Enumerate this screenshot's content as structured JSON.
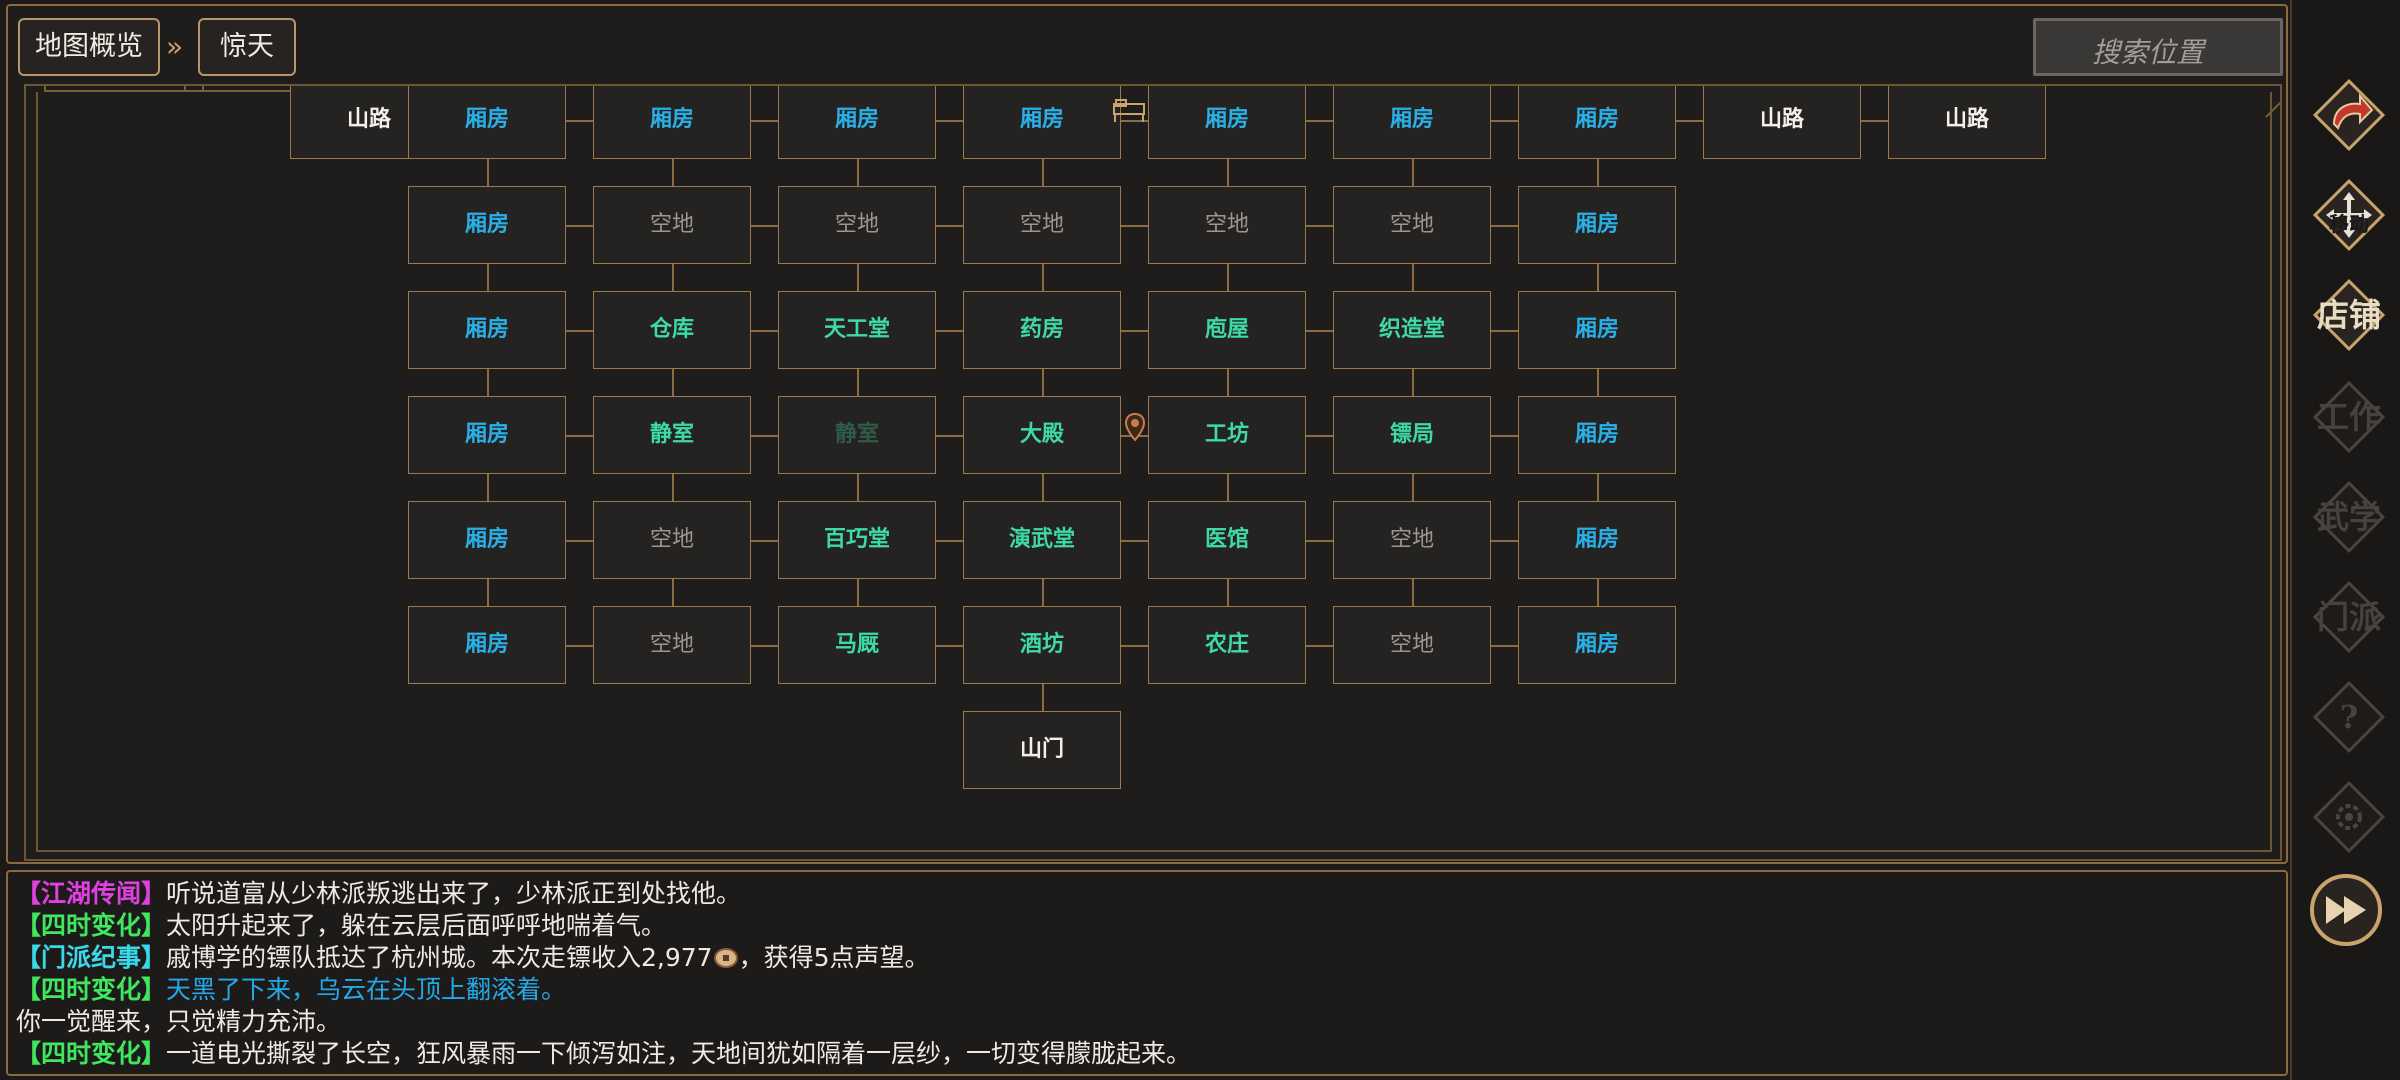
{
  "breadcrumb": {
    "overview_label": "地图概览",
    "separator": "»",
    "current_label": "惊天"
  },
  "search": {
    "placeholder": "搜索位置"
  },
  "map": {
    "rows": [
      [
        {
          "label": "山路",
          "kind": "road"
        },
        {
          "label": "厢房",
          "kind": "wing"
        },
        {
          "label": "厢房",
          "kind": "wing"
        },
        {
          "label": "厢房",
          "kind": "wing"
        },
        {
          "label": "厢房",
          "kind": "wing"
        },
        {
          "label": "厢房",
          "kind": "wing"
        },
        {
          "label": "厢房",
          "kind": "wing"
        },
        {
          "label": "厢房",
          "kind": "wing"
        },
        {
          "label": "山路",
          "kind": "road"
        },
        {
          "label": "山路",
          "kind": "road"
        }
      ],
      [
        null,
        {
          "label": "厢房",
          "kind": "wing"
        },
        {
          "label": "空地",
          "kind": "empty"
        },
        {
          "label": "空地",
          "kind": "empty"
        },
        {
          "label": "空地",
          "kind": "empty"
        },
        {
          "label": "空地",
          "kind": "empty"
        },
        {
          "label": "空地",
          "kind": "empty"
        },
        {
          "label": "厢房",
          "kind": "wing"
        },
        null,
        null
      ],
      [
        null,
        {
          "label": "厢房",
          "kind": "wing"
        },
        {
          "label": "仓库",
          "kind": "building"
        },
        {
          "label": "天工堂",
          "kind": "building"
        },
        {
          "label": "药房",
          "kind": "building"
        },
        {
          "label": "庖屋",
          "kind": "building"
        },
        {
          "label": "织造堂",
          "kind": "building"
        },
        {
          "label": "厢房",
          "kind": "wing"
        },
        null,
        null
      ],
      [
        null,
        {
          "label": "厢房",
          "kind": "wing"
        },
        {
          "label": "静室",
          "kind": "building"
        },
        {
          "label": "静室",
          "kind": "dim"
        },
        {
          "label": "大殿",
          "kind": "building"
        },
        {
          "label": "工坊",
          "kind": "building"
        },
        {
          "label": "镖局",
          "kind": "building"
        },
        {
          "label": "厢房",
          "kind": "wing"
        },
        null,
        null
      ],
      [
        null,
        {
          "label": "厢房",
          "kind": "wing"
        },
        {
          "label": "空地",
          "kind": "empty"
        },
        {
          "label": "百巧堂",
          "kind": "building"
        },
        {
          "label": "演武堂",
          "kind": "building"
        },
        {
          "label": "医馆",
          "kind": "building"
        },
        {
          "label": "空地",
          "kind": "empty"
        },
        {
          "label": "厢房",
          "kind": "wing"
        },
        null,
        null
      ],
      [
        null,
        {
          "label": "厢房",
          "kind": "wing"
        },
        {
          "label": "空地",
          "kind": "empty"
        },
        {
          "label": "马厩",
          "kind": "building"
        },
        {
          "label": "酒坊",
          "kind": "building"
        },
        {
          "label": "农庄",
          "kind": "building"
        },
        {
          "label": "空地",
          "kind": "empty"
        },
        {
          "label": "厢房",
          "kind": "wing"
        },
        null,
        null
      ],
      [
        null,
        null,
        null,
        null,
        {
          "label": "山门",
          "kind": "road"
        },
        null,
        null,
        null,
        null,
        null
      ]
    ]
  },
  "side_menu": [
    {
      "name": "back-button",
      "label": "",
      "icon": "return-arrow-icon",
      "enabled": true
    },
    {
      "name": "move-button",
      "label": "移动",
      "icon": "move-arrows-icon",
      "enabled": true
    },
    {
      "name": "shop-button",
      "label": "店铺",
      "icon": "shop-icon",
      "enabled": true
    },
    {
      "name": "work-button",
      "label": "工作",
      "icon": "work-icon",
      "enabled": false
    },
    {
      "name": "martial-button",
      "label": "武学",
      "icon": "martial-icon",
      "enabled": false
    },
    {
      "name": "sect-button",
      "label": "门派",
      "icon": "sect-icon",
      "enabled": false
    },
    {
      "name": "help-button",
      "label": "?",
      "icon": "question-icon",
      "enabled": false
    },
    {
      "name": "settings-button",
      "label": "",
      "icon": "gear-icon",
      "enabled": false
    }
  ],
  "fast_forward": {
    "icon": "fast-forward-icon"
  },
  "log": [
    {
      "tag": "【江湖传闻】",
      "tag_kind": "rumor",
      "text": "听说道富从少林派叛逃出来了，少林派正到处找他。",
      "text_kind": "normal"
    },
    {
      "tag": "【四时变化】",
      "tag_kind": "season",
      "text": "太阳升起来了，躲在云层后面呼呼地喘着气。",
      "text_kind": "normal"
    },
    {
      "tag": "【门派纪事】",
      "tag_kind": "sect",
      "text": "戚博学的镖队抵达了杭州城。本次走镖收入2,977",
      "coin": true,
      "text_after": "，获得5点声望。",
      "text_kind": "normal"
    },
    {
      "tag": "【四时变化】",
      "tag_kind": "season",
      "text": "天黑了下来，乌云在头顶上翻滚着。",
      "text_kind": "night"
    },
    {
      "tag": "",
      "tag_kind": "none",
      "text": "你一觉醒来，只觉精力充沛。",
      "text_kind": "normal"
    },
    {
      "tag": "【四时变化】",
      "tag_kind": "season",
      "text": "一道电光撕裂了长空，狂风暴雨一下倾泻如注，天地间犹如隔着一层纱，一切变得朦胧起来。",
      "text_kind": "normal"
    }
  ],
  "colors": {
    "wing": "#2ab0e8",
    "building": "#3ed9a8",
    "empty": "#9a9792",
    "road": "#f3f0ea",
    "border_gold": "#9c7a4e",
    "rumor": "#e040e0",
    "season": "#3fe65e",
    "sect": "#3ad8e8"
  }
}
